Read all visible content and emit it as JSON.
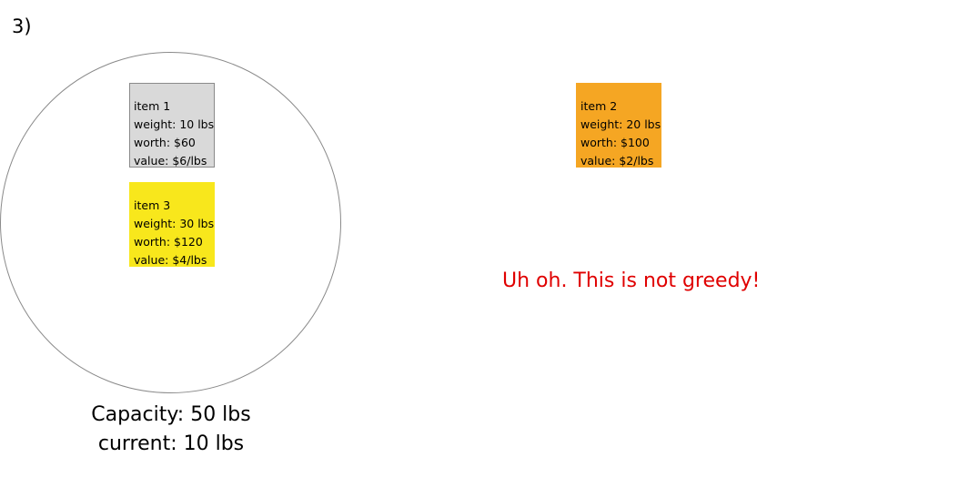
{
  "step_label": "3)",
  "knapsack": {
    "capacity_text": "Capacity: 50 lbs",
    "current_text": "current: 10 lbs"
  },
  "items": {
    "item1": {
      "title": "item 1",
      "weight": "weight: 10 lbs",
      "worth": "worth: $60",
      "value": "value: $6/lbs",
      "color": "#d9d9d9"
    },
    "item2": {
      "title": "item 2",
      "weight": "weight: 20 lbs",
      "worth": "worth: $100",
      "value": "value: $2/lbs",
      "color": "#f5a623"
    },
    "item3": {
      "title": "item 3",
      "weight": "weight: 30 lbs",
      "worth": "worth: $120",
      "value": "value: $4/lbs",
      "color": "#f8e71c"
    }
  },
  "warning": {
    "text": "Uh oh. This is not greedy!",
    "color": "#e00000"
  }
}
